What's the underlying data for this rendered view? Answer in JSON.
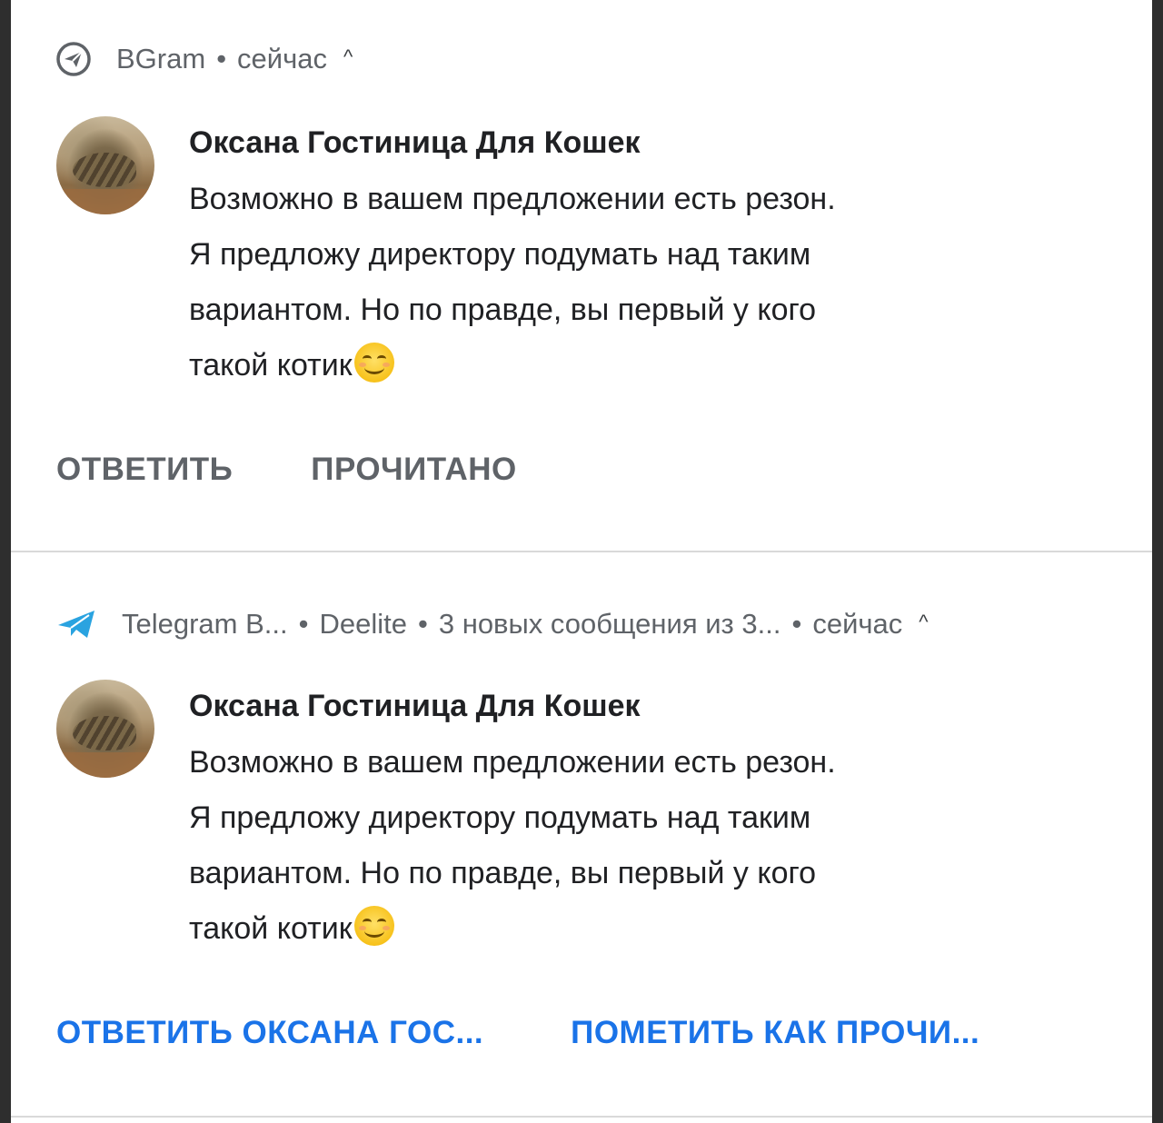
{
  "notifications": [
    {
      "app_name": "BGram",
      "time": "сейчас",
      "sender": "Оксана Гостиница Для Кошек",
      "message_lines": [
        "Возможно в вашем предложении есть резон.",
        "Я предложу директору подумать над таким",
        "вариантом. Но по правде, вы первый у кого",
        "такой котик"
      ],
      "actions": [
        "ОТВЕТИТЬ",
        "ПРОЧИТАНО"
      ]
    },
    {
      "app_name": "Telegram B...",
      "account": "Deelite",
      "summary": "3 новых сообщения из 3...",
      "time": "сейчас",
      "sender": "Оксана Гостиница Для Кошек",
      "message_lines": [
        "Возможно в вашем предложении есть резон.",
        "Я предложу директору подумать над таким",
        "вариантом. Но по правде, вы первый у кого",
        "такой котик"
      ],
      "actions": [
        "ОТВЕТИТЬ ОКСАНА ГОС...",
        "ПОМЕТИТЬ КАК ПРОЧИ..."
      ]
    }
  ],
  "icons": {
    "bgram": "paper-plane-circle-icon",
    "telegram": "telegram-plane-icon",
    "emoji": "smiling-face-emoji"
  },
  "colors": {
    "accent_blue": "#1a73e8",
    "telegram_blue": "#2aa3e0",
    "secondary_text": "#5f6368"
  }
}
